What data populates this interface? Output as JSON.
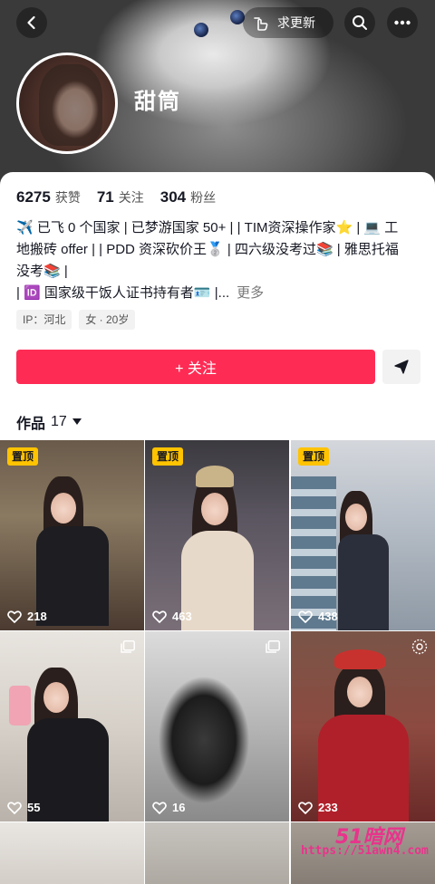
{
  "header": {
    "update_label": "求更新"
  },
  "profile": {
    "nickname": "甜筒",
    "stats": [
      {
        "value": "6275",
        "label": "获赞"
      },
      {
        "value": "71",
        "label": "关注"
      },
      {
        "value": "304",
        "label": "粉丝"
      }
    ],
    "bio_lines": [
      "✈️ 已飞 0 个国家 | 已梦游国家 50+ |  |  TIM资深操作家⭐ |  💻 工",
      "地搬砖 offer  | | PDD 资深砍价王🥈 | 四六级没考过📚 | 雅思托福",
      "没考📚 |",
      "|  🆔 国家级干饭人证书持有者🪪 |..."
    ],
    "bio_more": "更多",
    "tags": [
      "IP：河北",
      "女 · 20岁"
    ],
    "follow_label": "+ 关注"
  },
  "works": {
    "label": "作品",
    "count": "17",
    "items": [
      {
        "pinned": "置顶",
        "likes": "218"
      },
      {
        "pinned": "置顶",
        "likes": "463"
      },
      {
        "pinned": "置顶",
        "likes": "438"
      },
      {
        "likes": "55"
      },
      {
        "likes": "16"
      },
      {
        "likes": "233"
      }
    ]
  },
  "watermark": {
    "brand": "51暗网",
    "url": "https://51awn4.com"
  },
  "colors": {
    "accent": "#fe2c55",
    "pin": "#ffc300"
  }
}
